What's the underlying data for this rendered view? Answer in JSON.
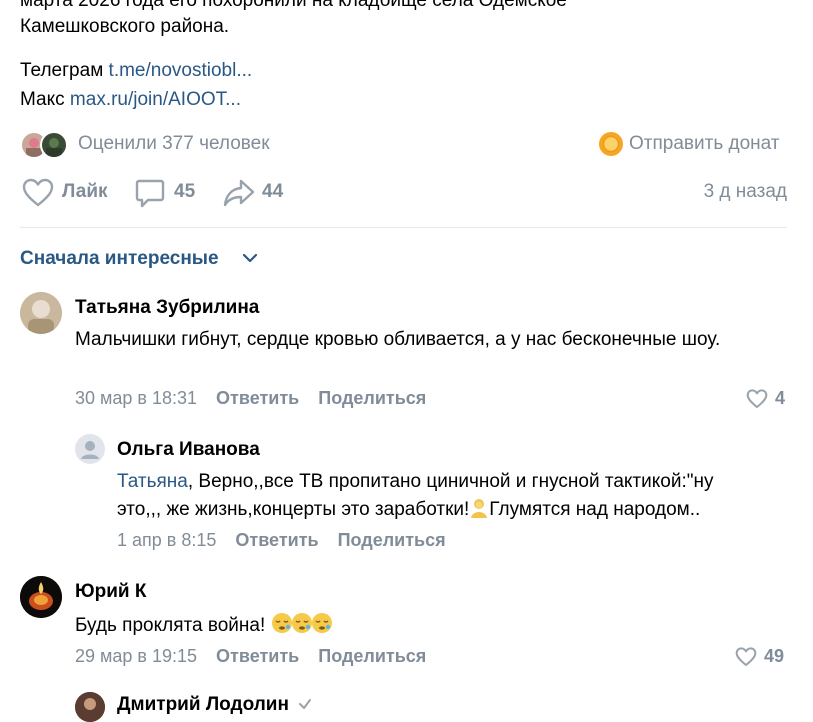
{
  "post": {
    "text_line1_fragment": "марта 2026 года его похоронили на кладбище села Одемское",
    "text_line2": "Камешковского района.",
    "telegram_label": "Телеграм",
    "telegram_link": "t.me/novostiobl...",
    "max_label": "Макс",
    "max_link": "max.ru/join/AIOOT...",
    "rated_text": "Оценили 377 человек",
    "donate_label": "Отправить донат",
    "like_label": "Лайк",
    "comments_count": "45",
    "shares_count": "44",
    "time_ago": "3 д назад"
  },
  "comments_sort": {
    "label": "Сначала интересные"
  },
  "comments": [
    {
      "author": "Татьяна Зубрилина",
      "text": "Мальчишки гибнут, сердце кровью обливается, а у нас бесконечные шоу.",
      "date": "30 мар в 18:31",
      "reply_label": "Ответить",
      "share_label": "Поделиться",
      "likes": "4"
    },
    {
      "author": "Ольга Иванова",
      "mention": "Татьяна",
      "text_part1": ", Верно,,все ТВ пропитано циничной и гнусной тактикой:\"ну",
      "text_part2": "это,,, же жизнь,концерты это заработки!",
      "text_part3": "Глумятся над народом..",
      "date": "1 апр в 8:15",
      "reply_label": "Ответить",
      "share_label": "Поделиться"
    },
    {
      "author": "Юрий К",
      "text": "Будь проклята война!",
      "date": "29 мар в 19:15",
      "reply_label": "Ответить",
      "share_label": "Поделиться",
      "likes": "49"
    },
    {
      "author": "Дмитрий Лодолин"
    }
  ],
  "colors": {
    "link": "#2a5885",
    "muted": "#818c99",
    "divider": "#e7e8ec",
    "icon": "#99a2ad"
  }
}
